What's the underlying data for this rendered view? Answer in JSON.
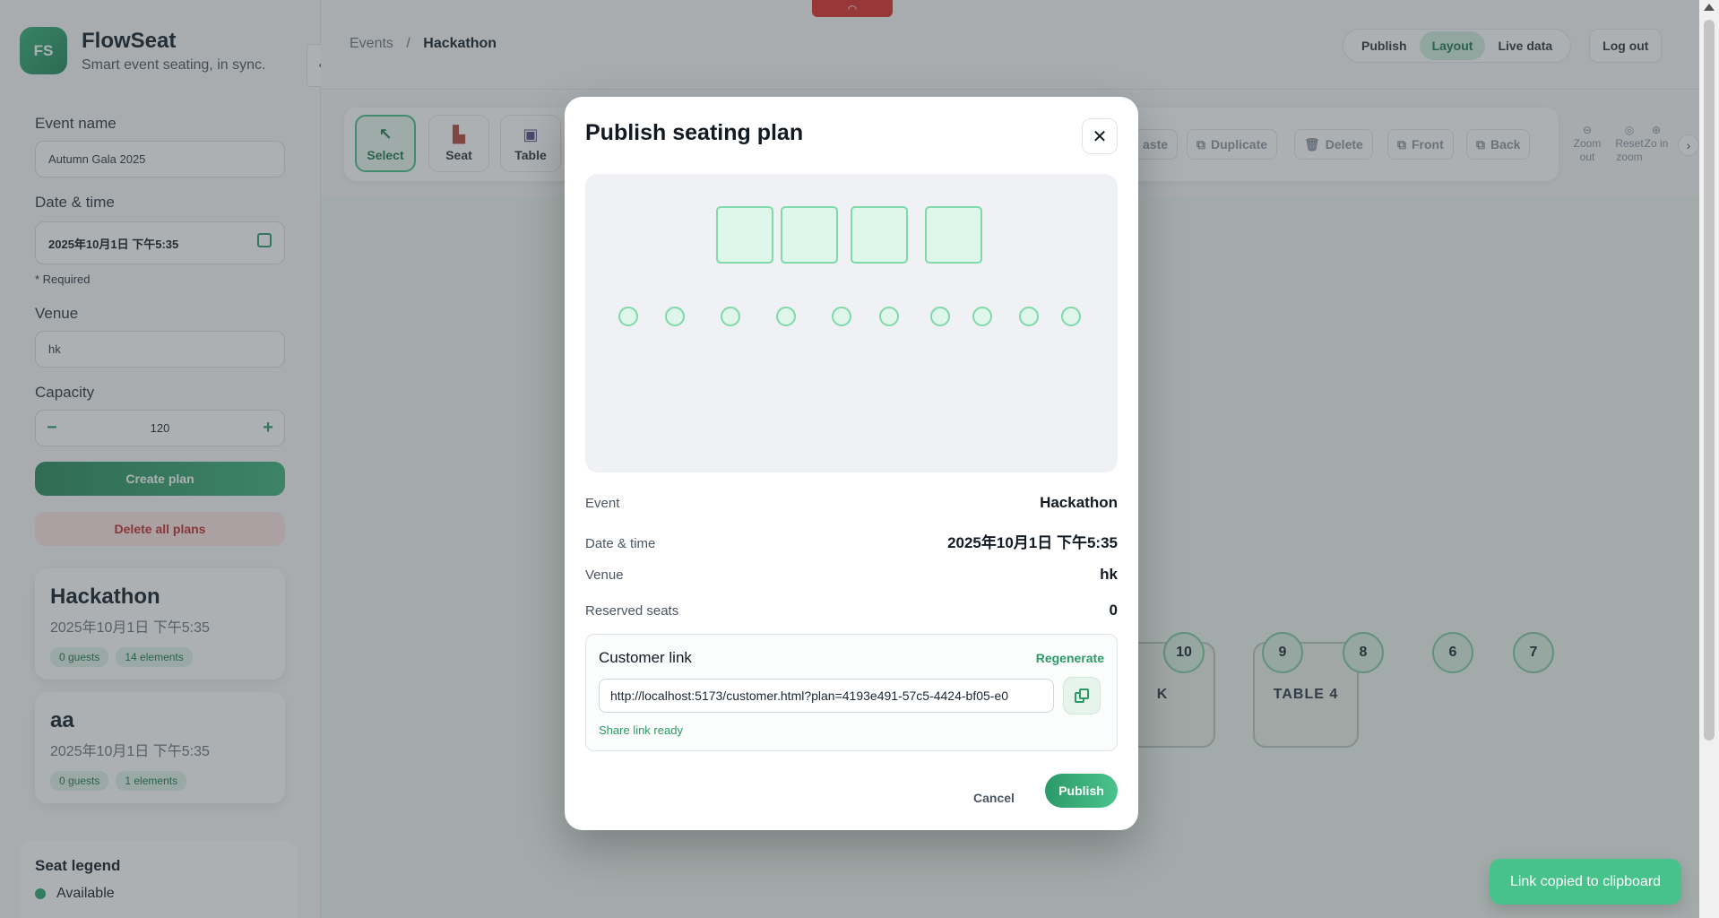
{
  "brand": {
    "logo_initials": "FS",
    "name": "FlowSeat",
    "tagline": "Smart event seating, in sync."
  },
  "form": {
    "event_name_label": "Event name",
    "event_name_value": "Autumn Gala 2025",
    "datetime_label": "Date & time",
    "datetime_value": "2025年10月1日 下午5:35",
    "required_note": "* Required",
    "venue_label": "Venue",
    "venue_value": "hk",
    "capacity_label": "Capacity",
    "capacity_value": "120",
    "minus": "−",
    "plus": "+",
    "create_button": "Create plan",
    "delete_all_button": "Delete all plans"
  },
  "plans": [
    {
      "name": "Hackathon",
      "date": "2025年10月1日 下午5:35",
      "guests": "0 guests",
      "elements": "14 elements"
    },
    {
      "name": "aa",
      "date": "2025年10月1日 下午5:35",
      "guests": "0 guests",
      "elements": "1 elements"
    }
  ],
  "legend": {
    "title": "Seat legend",
    "available": "Available",
    "colors": {
      "available": "#2fa56f"
    }
  },
  "breadcrumb": {
    "root": "Events",
    "sep": "/",
    "current": "Hackathon"
  },
  "nav": {
    "publish": "Publish",
    "layout": "Layout",
    "live": "Live data",
    "logout": "Log out"
  },
  "toolbar": {
    "select": "Select",
    "seat": "Seat",
    "table": "Table",
    "paste": "aste",
    "duplicate": "Duplicate",
    "delete": "Delete",
    "front": "Front",
    "back": "Back",
    "zoom_out": "Zoom out",
    "reset_zoom": "Reset zoom",
    "zoom_in": "Zo in"
  },
  "canvas": {
    "tables": [
      "K",
      "TABLE 4"
    ],
    "seats": [
      "10",
      "9",
      "8",
      "6",
      "7"
    ]
  },
  "modal": {
    "title": "Publish seating plan",
    "close": "✕",
    "preview": {
      "tables": 4,
      "seats": 10
    },
    "event_label": "Event",
    "event_value": "Hackathon",
    "datetime_label": "Date & time",
    "datetime_value": "2025年10月1日 下午5:35",
    "venue_label": "Venue",
    "venue_value": "hk",
    "reserved_label": "Reserved seats",
    "reserved_value": "0",
    "link_title": "Customer link",
    "regenerate": "Regenerate",
    "link_value": "http://localhost:5173/customer.html?plan=4193e491-57c5-4424-bf05-e0",
    "share_ready": "Share link ready",
    "cancel": "Cancel",
    "publish": "Publish"
  },
  "toast": "Link copied to clipboard",
  "colors": {
    "accent": "#2c9a66",
    "danger": "#c03030",
    "record": "#d9302b"
  }
}
